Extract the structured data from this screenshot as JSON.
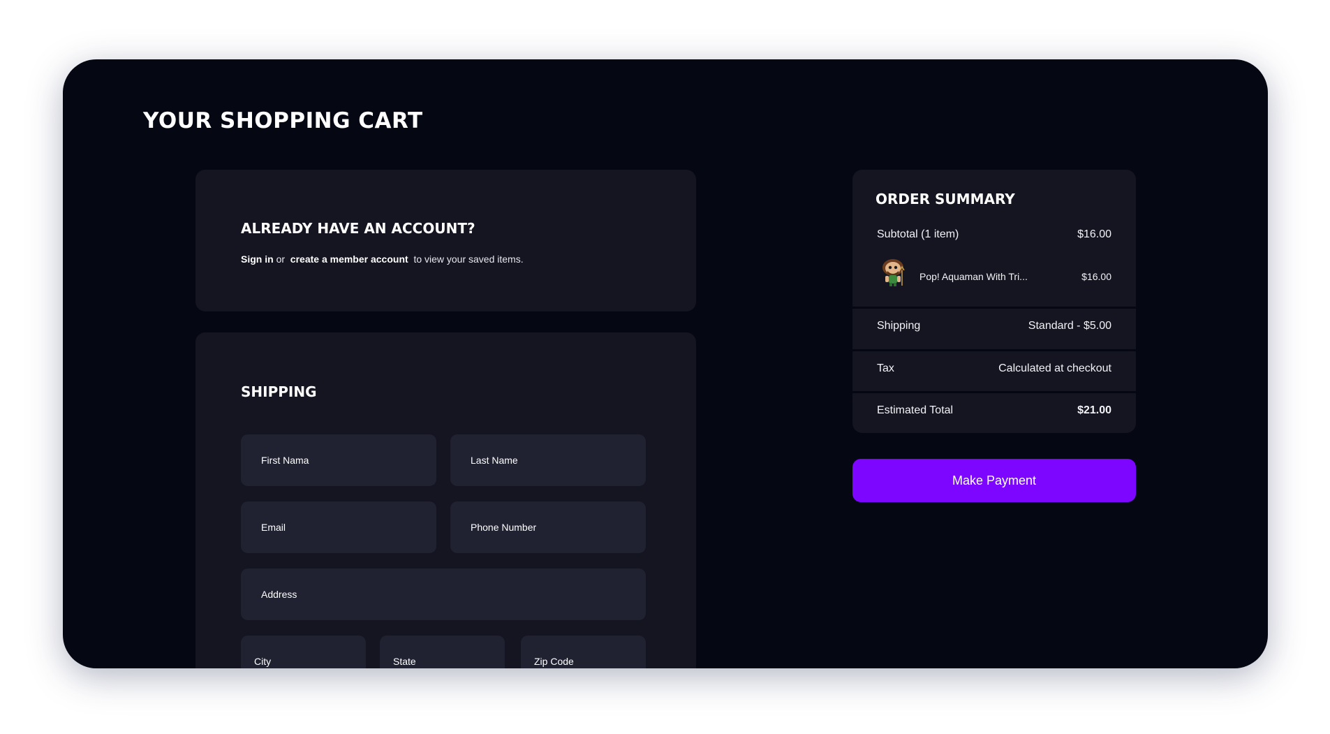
{
  "page": {
    "title": "YOUR SHOPPING CART"
  },
  "account": {
    "heading": "ALREADY HAVE AN ACCOUNT?",
    "sign_in": "Sign in",
    "or": "or",
    "create_account": "create a member account",
    "suffix": "to view your saved items."
  },
  "shipping": {
    "heading": "SHIPPING",
    "fields": {
      "first_name": "First Nama",
      "last_name": "Last Name",
      "email": "Email",
      "phone": "Phone Number",
      "address": "Address",
      "city": "City",
      "state": "State",
      "zip": "Zip Code"
    }
  },
  "summary": {
    "title": "ORDER SUMMARY",
    "subtotal_label": "Subtotal (1 item)",
    "subtotal_value": "$16.00",
    "item": {
      "name": "Pop! Aquaman With Tri...",
      "price": "$16.00",
      "icon": "funko-pop-figure-icon"
    },
    "shipping_label": "Shipping",
    "shipping_value": "Standard - $5.00",
    "tax_label": "Tax",
    "tax_value": "Calculated at checkout",
    "total_label": "Estimated Total",
    "total_value": "$21.00"
  },
  "actions": {
    "pay_label": "Make Payment"
  },
  "colors": {
    "background": "#050713",
    "card": "#141520",
    "field": "#202231",
    "accent": "#7c06ff"
  }
}
